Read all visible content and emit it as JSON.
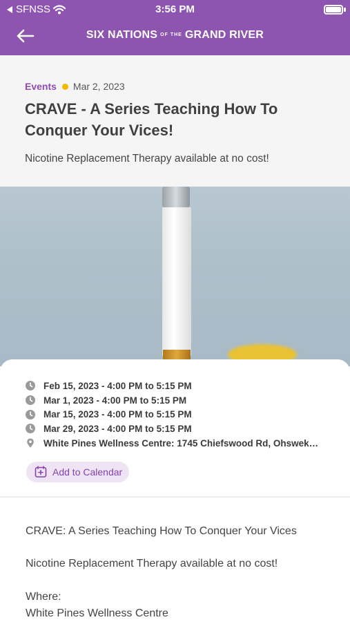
{
  "status": {
    "carrier": "SFNSS",
    "time": "3:56 PM"
  },
  "header": {
    "brand_main_left": "SIX NATIONS",
    "brand_small": "OF THE",
    "brand_main_right": "GRAND RIVER"
  },
  "article": {
    "category": "Events",
    "date": "Mar 2, 2023",
    "title": "CRAVE - A Series Teaching How To Conquer Your Vices!",
    "subtitle": "Nicotine Replacement Therapy available at no cost!"
  },
  "details": {
    "sessions": [
      "Feb 15, 2023 - 4:00 PM to 5:15 PM",
      "Mar 1, 2023 - 4:00 PM to 5:15 PM",
      "Mar 15, 2023 - 4:00 PM to 5:15 PM",
      "Mar 29, 2023 - 4:00 PM to 5:15 PM"
    ],
    "location": "White Pines Wellness Centre: 1745 Chiefswood Rd, Ohswek…",
    "add_to_calendar": "Add to Calendar"
  },
  "body": {
    "p1": "CRAVE: A Series Teaching How To Conquer Your Vices",
    "p2": "Nicotine Replacement Therapy available at no cost!",
    "p3": "Where:",
    "p4": "White Pines Wellness Centre"
  },
  "colors": {
    "header": "#8e55b0",
    "accent": "#8e4bb0",
    "dot": "#f5b800"
  }
}
